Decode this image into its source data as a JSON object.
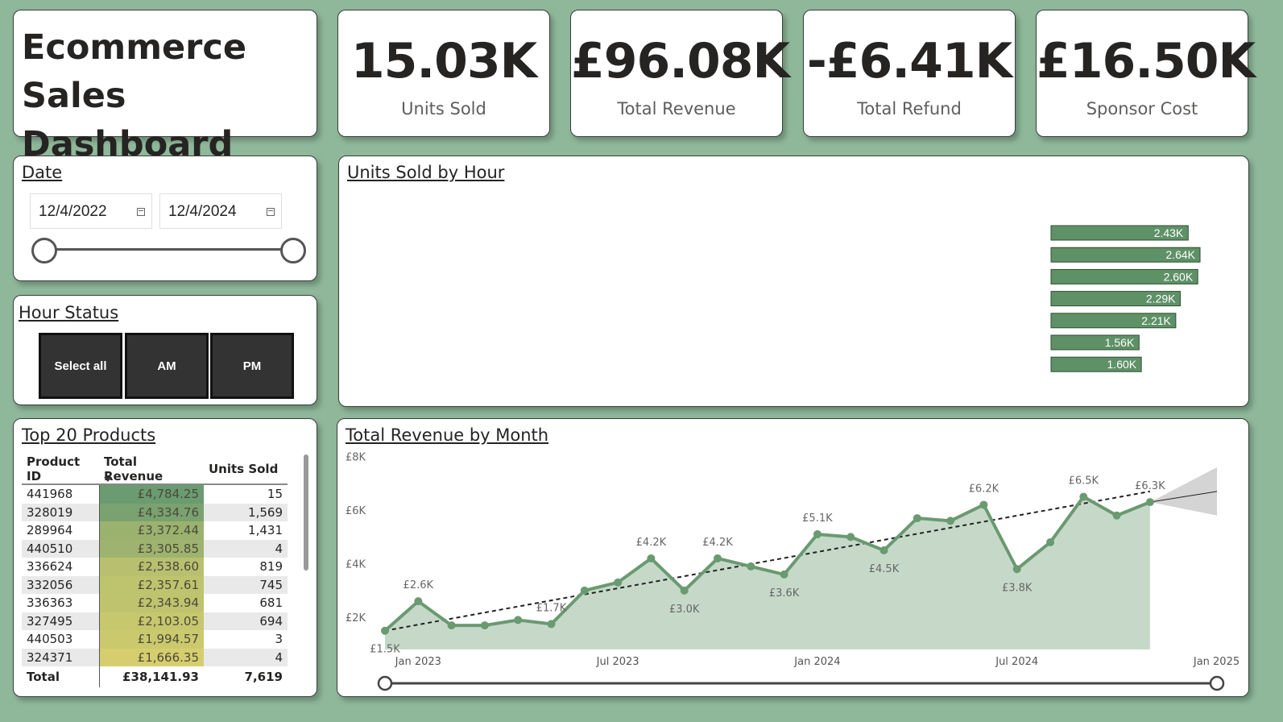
{
  "title": {
    "line1": "Ecommerce",
    "line2": "Sales Dashboard"
  },
  "kpis": [
    {
      "value": "15.03K",
      "label": "Units Sold"
    },
    {
      "value": "£96.08K",
      "label": "Total Revenue"
    },
    {
      "value": "-£6.41K",
      "label": "Total Refund"
    },
    {
      "value": "£16.50K",
      "label": "Sponsor Cost"
    }
  ],
  "date_slicer": {
    "title": "Date",
    "start": "12/4/2022",
    "end": "12/4/2024"
  },
  "hour_status": {
    "title": "Hour Status",
    "buttons": [
      "Select all",
      "AM",
      "PM"
    ]
  },
  "top_products": {
    "title": "Top 20 Products",
    "columns": [
      "Product ID",
      "Total Revenue",
      "Units Sold"
    ],
    "rows": [
      {
        "id": "441968",
        "revenue": "£4,784.25",
        "units": "15",
        "revenue_value": 4784.25
      },
      {
        "id": "328019",
        "revenue": "£4,334.76",
        "units": "1,569",
        "revenue_value": 4334.76
      },
      {
        "id": "289964",
        "revenue": "£3,372.44",
        "units": "1,431",
        "revenue_value": 3372.44
      },
      {
        "id": "440510",
        "revenue": "£3,305.85",
        "units": "4",
        "revenue_value": 3305.85
      },
      {
        "id": "336624",
        "revenue": "£2,538.60",
        "units": "819",
        "revenue_value": 2538.6
      },
      {
        "id": "332056",
        "revenue": "£2,357.61",
        "units": "745",
        "revenue_value": 2357.61
      },
      {
        "id": "336363",
        "revenue": "£2,343.94",
        "units": "681",
        "revenue_value": 2343.94
      },
      {
        "id": "327495",
        "revenue": "£2,103.05",
        "units": "694",
        "revenue_value": 2103.05
      },
      {
        "id": "440503",
        "revenue": "£1,994.57",
        "units": "3",
        "revenue_value": 1994.57
      },
      {
        "id": "324371",
        "revenue": "£1,666.35",
        "units": "4",
        "revenue_value": 1666.35
      }
    ],
    "total": {
      "label": "Total",
      "revenue": "£38,141.93",
      "units": "7,619"
    }
  },
  "units_by_hour": {
    "title": "Units Sold by Hour",
    "bar_color": "#5f9167",
    "bars": [
      {
        "value": 2430,
        "label": "2.43K"
      },
      {
        "value": 2640,
        "label": "2.64K"
      },
      {
        "value": 2600,
        "label": "2.60K"
      },
      {
        "value": 2290,
        "label": "2.29K"
      },
      {
        "value": 2210,
        "label": "2.21K"
      },
      {
        "value": 1560,
        "label": "1.56K"
      },
      {
        "value": 1600,
        "label": "1.60K"
      }
    ]
  },
  "revenue_by_month": {
    "title": "Total Revenue by Month",
    "line_color": "#6a9a70",
    "yticks": [
      "£8K",
      "£6K",
      "£4K",
      "£2K"
    ],
    "xticks": [
      "Jan 2023",
      "Jul 2023",
      "Jan 2024",
      "Jul 2024",
      "Jan 2025"
    ]
  },
  "chart_data": {
    "type": "line",
    "title": "Total Revenue by Month",
    "xlabel": "",
    "ylabel": "",
    "ylim": [
      800,
      8000
    ],
    "x": [
      "2022-12",
      "2023-01",
      "2023-02",
      "2023-03",
      "2023-04",
      "2023-05",
      "2023-06",
      "2023-07",
      "2023-08",
      "2023-09",
      "2023-10",
      "2023-11",
      "2023-12",
      "2024-01",
      "2024-02",
      "2024-03",
      "2024-04",
      "2024-05",
      "2024-06",
      "2024-07",
      "2024-08",
      "2024-09",
      "2024-10",
      "2024-11"
    ],
    "series": [
      {
        "values": [
          1500,
          2600,
          1700,
          1700,
          1900,
          1750,
          3000,
          3300,
          4200,
          3000,
          4200,
          3900,
          3600,
          5100,
          5000,
          4500,
          5700,
          5600,
          6200,
          3800,
          4800,
          6500,
          5800,
          6300
        ]
      }
    ],
    "data_labels": [
      {
        "index": 0,
        "label": "£1.5K"
      },
      {
        "index": 1,
        "label": "£2.6K"
      },
      {
        "index": 5,
        "label": "£1.7K"
      },
      {
        "index": 8,
        "label": "£4.2K"
      },
      {
        "index": 9,
        "label": "£3.0K"
      },
      {
        "index": 10,
        "label": "£4.2K"
      },
      {
        "index": 12,
        "label": "£3.6K"
      },
      {
        "index": 13,
        "label": "£5.1K"
      },
      {
        "index": 15,
        "label": "£4.5K"
      },
      {
        "index": 18,
        "label": "£6.2K"
      },
      {
        "index": 19,
        "label": "£3.8K"
      },
      {
        "index": 21,
        "label": "£6.5K"
      },
      {
        "index": 23,
        "label": "£6.3K"
      }
    ],
    "trend_line": {
      "start": 1500,
      "end": 6700
    },
    "forecast": {
      "center_end": 6700,
      "upper_end": 7600,
      "lower_end": 5800
    }
  }
}
